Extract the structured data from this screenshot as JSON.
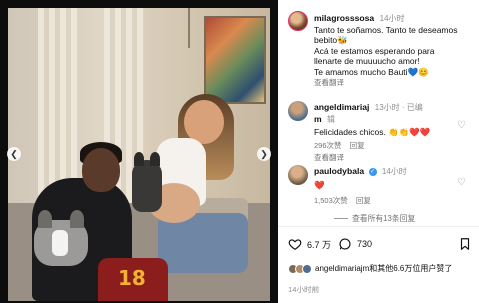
{
  "post": {
    "caption": {
      "username": "milagrosssosa",
      "time": "14小时",
      "lines": [
        "Tanto te soñamos. Tanto te deseamos",
        "bebito🐝",
        "Acá te estamos esperando para",
        "llenarte de muuuucho amor!",
        "Te amamos mucho Bauti💙😊"
      ],
      "see_translation": "查看翻译"
    },
    "photo": {
      "jersey_number": "18"
    },
    "comments": [
      {
        "username": "angeldimariaj",
        "username_tail": "m",
        "time": "13小时 · 已编",
        "time_tail": "辑",
        "text": "Felicidades chicos. 👏👏❤️❤️",
        "likes": "296次赞",
        "reply": "回复",
        "see_translation": "查看翻译"
      },
      {
        "username": "paulodybala",
        "time": "14小时",
        "text": "❤️",
        "likes": "1,503次赞",
        "reply": "回复"
      }
    ],
    "view_replies": "查看所有13条回复",
    "actions": {
      "like_count": "6.7 万",
      "comment_count": "730"
    },
    "liked_by": "angeldimariajm和其他6.6万位用户赞了",
    "posted_ago": "14小时前"
  },
  "icons": {
    "prev": "chevron-left-icon",
    "next": "chevron-right-icon",
    "like": "heart-icon",
    "comment": "comment-icon",
    "save": "bookmark-icon"
  },
  "colors": {
    "verified": "#3897f0",
    "heart": "#e02a2a"
  }
}
